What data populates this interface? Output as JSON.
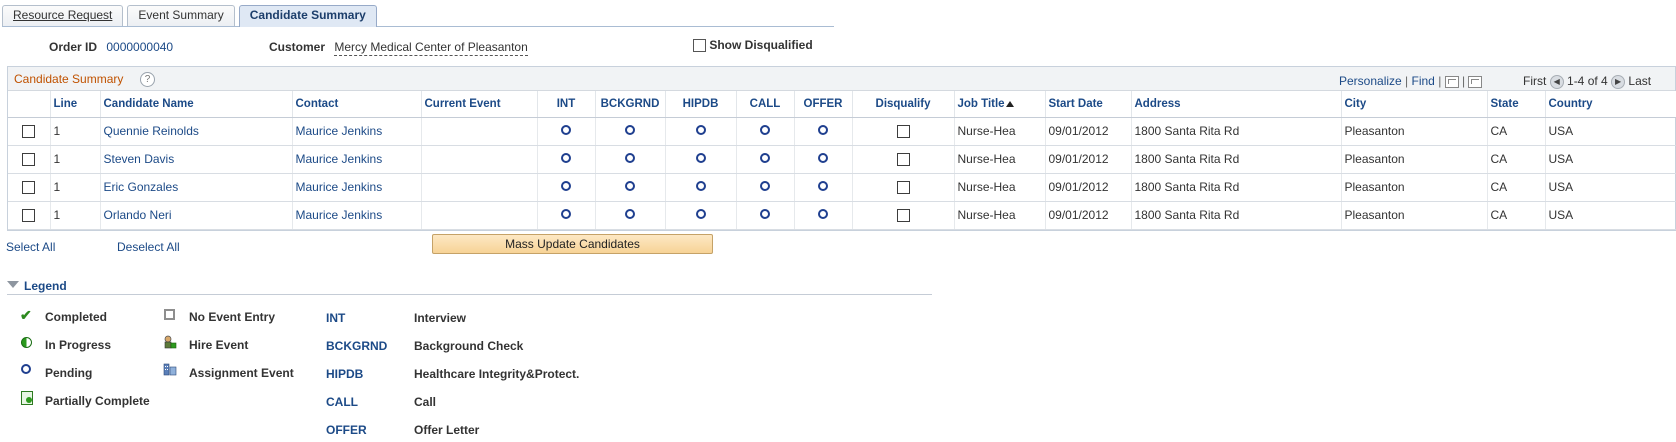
{
  "tabs": [
    {
      "label": "Resource Request",
      "active": false
    },
    {
      "label": "Event Summary",
      "active": false
    },
    {
      "label": "Candidate Summary",
      "active": true
    }
  ],
  "header": {
    "order_id_label": "Order ID",
    "order_id_value": "0000000040",
    "customer_label": "Customer",
    "customer_value": "Mercy Medical Center of Pleasanton",
    "show_disqualified_label": "Show Disqualified"
  },
  "grid": {
    "title": "Candidate Summary",
    "help": "?",
    "personalize": "Personalize",
    "find": "Find",
    "first": "First",
    "range": "1-4 of 4",
    "last": "Last",
    "columns": [
      "Line",
      "Candidate Name",
      "Contact",
      "Current Event",
      "INT",
      "BCKGRND",
      "HIPDB",
      "CALL",
      "OFFER",
      "Disqualify",
      "Job Title",
      "Start Date",
      "Address",
      "City",
      "State",
      "Country"
    ],
    "rows": [
      {
        "line": "1",
        "name": "Quennie Reinolds",
        "contact": "Maurice Jenkins",
        "current_event": "",
        "job_title": "Nurse-Hea",
        "start_date": "09/01/2012",
        "address": "1800 Santa Rita Rd",
        "city": "Pleasanton",
        "state": "CA",
        "country": "USA"
      },
      {
        "line": "1",
        "name": "Steven Davis",
        "contact": "Maurice Jenkins",
        "current_event": "",
        "job_title": "Nurse-Hea",
        "start_date": "09/01/2012",
        "address": "1800 Santa Rita Rd",
        "city": "Pleasanton",
        "state": "CA",
        "country": "USA"
      },
      {
        "line": "1",
        "name": "Eric Gonzales",
        "contact": "Maurice Jenkins",
        "current_event": "",
        "job_title": "Nurse-Hea",
        "start_date": "09/01/2012",
        "address": "1800 Santa Rita Rd",
        "city": "Pleasanton",
        "state": "CA",
        "country": "USA"
      },
      {
        "line": "1",
        "name": "Orlando Neri",
        "contact": "Maurice Jenkins",
        "current_event": "",
        "job_title": "Nurse-Hea",
        "start_date": "09/01/2012",
        "address": "1800 Santa Rita Rd",
        "city": "Pleasanton",
        "state": "CA",
        "country": "USA"
      }
    ]
  },
  "actions": {
    "select_all": "Select All",
    "deselect_all": "Deselect All",
    "mass_update": "Mass Update Candidates"
  },
  "legend": {
    "title": "Legend",
    "status": [
      {
        "icon": "check-icon",
        "label": "Completed"
      },
      {
        "icon": "in-progress-icon",
        "label": "In Progress"
      },
      {
        "icon": "pending-icon",
        "label": "Pending"
      },
      {
        "icon": "partially-complete-icon",
        "label": "Partially Complete"
      }
    ],
    "events": [
      {
        "icon": "no-event-entry-icon",
        "label": "No Event Entry"
      },
      {
        "icon": "hire-event-icon",
        "label": "Hire Event"
      },
      {
        "icon": "assignment-event-icon",
        "label": "Assignment Event"
      }
    ],
    "codes": [
      {
        "code": "INT",
        "desc": "Interview"
      },
      {
        "code": "BCKGRND",
        "desc": "Background Check"
      },
      {
        "code": "HIPDB",
        "desc": "Healthcare Integrity&Protect."
      },
      {
        "code": "CALL",
        "desc": "Call"
      },
      {
        "code": "OFFER",
        "desc": "Offer Letter"
      }
    ]
  },
  "colors": {
    "link": "#1c4a87",
    "grid_title": "#c05200",
    "button": "#f7d396",
    "pending_ring": "#1f3f8f",
    "complete_check": "#2d8a1e"
  }
}
